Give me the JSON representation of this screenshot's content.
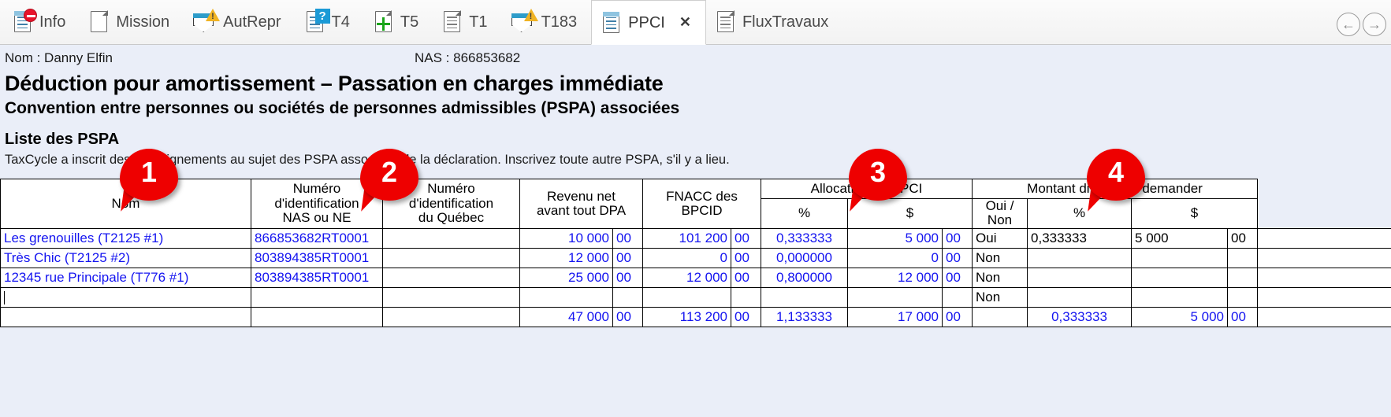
{
  "tabbar": {
    "tabs": [
      {
        "label": "Info",
        "icon": "document-minus-icon"
      },
      {
        "label": "Mission",
        "icon": "blank-page-icon"
      },
      {
        "label": "AutRepr",
        "icon": "envelope-warning-icon"
      },
      {
        "label": "T4",
        "icon": "document-question-icon"
      },
      {
        "label": "T5",
        "icon": "document-plus-icon"
      },
      {
        "label": "T1",
        "icon": "document-lines-icon"
      },
      {
        "label": "T183",
        "icon": "envelope-warning-icon"
      },
      {
        "label": "PPCI",
        "icon": "document-lines-blue-icon",
        "active": true,
        "close": "✕"
      },
      {
        "label": "FluxTravaux",
        "icon": "document-lines-icon"
      }
    ],
    "nav_back": "←",
    "nav_forward": "→"
  },
  "header": {
    "nom_label": "Nom : Danny Elfin",
    "nas_label": "NAS : 866853682",
    "title": "Déduction pour amortissement – Passation en charges immédiate",
    "subtitle": "Convention entre personnes ou sociétés de personnes admissibles (PSPA) associées",
    "section_title": "Liste des PSPA",
    "note": "TaxCycle a inscrit des renseignements au sujet des PSPA associées de la déclaration. Inscrivez toute autre PSPA, s'il y a lieu."
  },
  "table": {
    "group_headers": {
      "allocation": "Allocation du PPCI",
      "montant": "Montant différent à demander"
    },
    "columns": {
      "nom": "Nom",
      "nas_ne": "Numéro\nd'identification\nNAS ou NE",
      "quebec": "Numéro\nd'identification\ndu Québec",
      "revenu": "Revenu net\navant tout DPA",
      "fnacc": "FNACC des\nBPCID",
      "alloc_pct": "%",
      "alloc_dollar": "$",
      "oui_non": "Oui /\nNon",
      "diff_pct": "%",
      "diff_dollar": "$"
    },
    "rows": [
      {
        "nom": "Les grenouilles (T2125 #1)",
        "nas_ne": "866853682RT0001",
        "quebec": "",
        "revenu": "10 000",
        "revenu_c": "00",
        "fnacc": "101 200",
        "fnacc_c": "00",
        "alloc_pct": "0,333333",
        "alloc_dollar": "5 000",
        "alloc_dollar_c": "00",
        "oui_non": "Oui",
        "diff_pct": "0,333333",
        "diff_dollar": "5 000",
        "diff_dollar_c": "00"
      },
      {
        "nom": "Très Chic (T2125 #2)",
        "nas_ne": "803894385RT0001",
        "quebec": "",
        "revenu": "12 000",
        "revenu_c": "00",
        "fnacc": "0",
        "fnacc_c": "00",
        "alloc_pct": "0,000000",
        "alloc_dollar": "0",
        "alloc_dollar_c": "00",
        "oui_non": "Non",
        "diff_pct": "",
        "diff_dollar": "",
        "diff_dollar_c": ""
      },
      {
        "nom": "12345 rue Principale (T776 #1)",
        "nas_ne": "803894385RT0001",
        "quebec": "",
        "revenu": "25 000",
        "revenu_c": "00",
        "fnacc": "12 000",
        "fnacc_c": "00",
        "alloc_pct": "0,800000",
        "alloc_dollar": "12 000",
        "alloc_dollar_c": "00",
        "oui_non": "Non",
        "diff_pct": "",
        "diff_dollar": "",
        "diff_dollar_c": ""
      },
      {
        "nom": "",
        "nas_ne": "",
        "quebec": "",
        "revenu": "",
        "revenu_c": "",
        "fnacc": "",
        "fnacc_c": "",
        "alloc_pct": "",
        "alloc_dollar": "",
        "alloc_dollar_c": "",
        "oui_non": "Non",
        "diff_pct": "",
        "diff_dollar": "",
        "diff_dollar_c": ""
      }
    ],
    "totals": {
      "revenu": "47 000",
      "revenu_c": "00",
      "fnacc": "113 200",
      "fnacc_c": "00",
      "alloc_pct": "1,133333",
      "alloc_dollar": "17 000",
      "alloc_dollar_c": "00",
      "diff_pct": "0,333333",
      "diff_dollar": "5 000",
      "diff_dollar_c": "00"
    }
  },
  "markers": [
    {
      "num": "1"
    },
    {
      "num": "2"
    },
    {
      "num": "3"
    },
    {
      "num": "4"
    }
  ],
  "colors": {
    "marker": "#ee0000",
    "field_text": "#1414f0",
    "form_bg": "#eaeef8",
    "header_bg": "#e7ecf7"
  }
}
